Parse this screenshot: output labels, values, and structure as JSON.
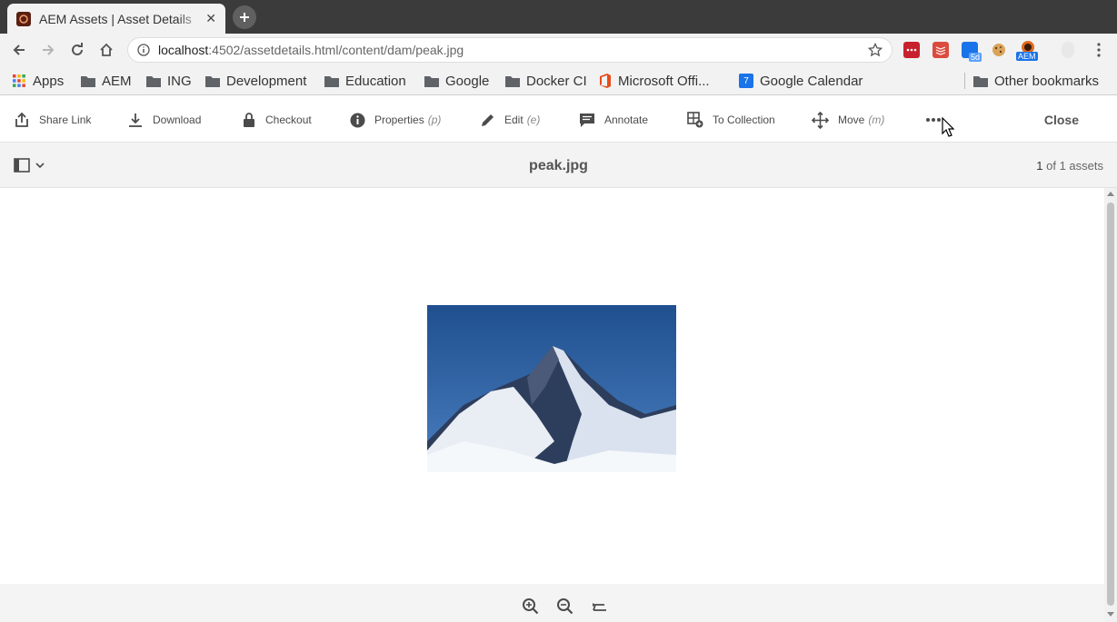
{
  "browser": {
    "tab_title": "AEM Assets | Asset Details",
    "url_host": "localhost",
    "url_path": ":4502/assetdetails.html/content/dam/peak.jpg",
    "bookmarks": [
      "Apps",
      "AEM",
      "ING",
      "Development",
      "Education",
      "Google",
      "Docker CI",
      "Microsoft Offi...",
      "Google Calendar"
    ],
    "other_bookmarks": "Other bookmarks",
    "calendar_day": "7",
    "ext_badge": "AEM",
    "ext_count": "5d"
  },
  "actionbar": {
    "share_link": "Share Link",
    "download": "Download",
    "checkout": "Checkout",
    "properties": "Properties",
    "properties_kb": "(p)",
    "edit": "Edit",
    "edit_kb": "(e)",
    "annotate": "Annotate",
    "to_collection": "To Collection",
    "move": "Move",
    "move_kb": "(m)",
    "close": "Close"
  },
  "titlebar": {
    "asset_name": "peak.jpg",
    "count_current": "1",
    "count_text": " of 1 assets"
  },
  "colors": {
    "tabstrip": "#3b3b3b",
    "chrome": "#f2f2f2",
    "sky": "#2d5d9a"
  }
}
